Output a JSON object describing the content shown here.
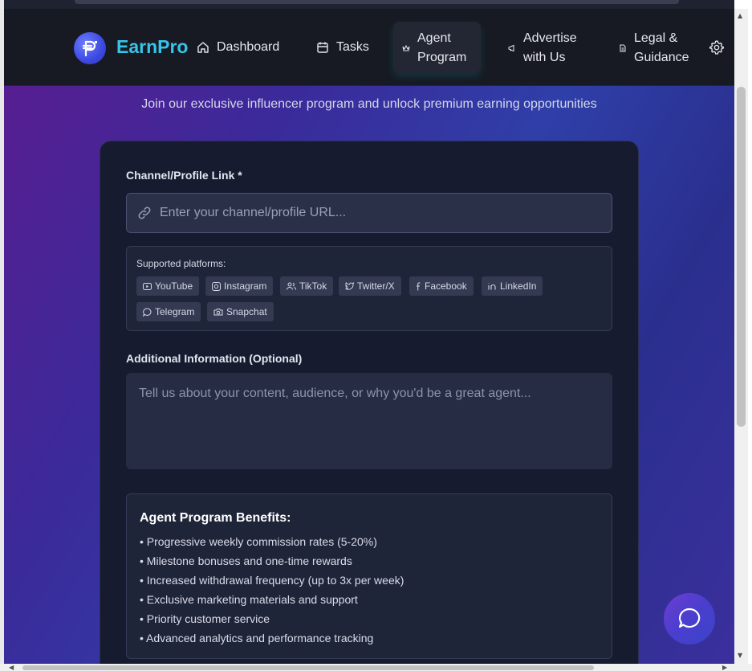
{
  "brand": {
    "name": "EarnPro",
    "logo_glyph": "₱"
  },
  "nav": {
    "items": [
      {
        "label_line1": "Dashboard",
        "label_line2": "",
        "icon": "home-icon"
      },
      {
        "label_line1": "Tasks",
        "label_line2": "",
        "icon": "calendar-icon"
      },
      {
        "label_line1": "Agent",
        "label_line2": "Program",
        "icon": "crown-icon",
        "active": true
      },
      {
        "label_line1": "Advertise",
        "label_line2": "with Us",
        "icon": "megaphone-icon"
      },
      {
        "label_line1": "Legal &",
        "label_line2": "Guidance",
        "icon": "document-icon"
      }
    ],
    "settings_icon": "gear-icon"
  },
  "hero": {
    "subtitle": "Join our exclusive influencer program and unlock premium earning opportunities"
  },
  "form": {
    "channel_label": "Channel/Profile Link *",
    "channel_placeholder": "Enter your channel/profile URL...",
    "channel_value": "",
    "platforms_title": "Supported platforms:",
    "platforms": [
      "YouTube",
      "Instagram",
      "TikTok",
      "Twitter/X",
      "Facebook",
      "LinkedIn",
      "Telegram",
      "Snapchat"
    ],
    "additional_label": "Additional Information (Optional)",
    "additional_placeholder": "Tell us about your content, audience, or why you'd be a great agent...",
    "additional_value": ""
  },
  "benefits": {
    "title": "Agent Program Benefits:",
    "items": [
      "• Progressive weekly commission rates (5-20%)",
      "• Milestone bonuses and one-time rewards",
      "• Increased withdrawal frequency (up to 3x per week)",
      "• Exclusive marketing materials and support",
      "• Priority customer service",
      "• Advanced analytics and performance tracking"
    ]
  },
  "colors": {
    "brand": "#38c4e8",
    "accent": "#4a3ecf",
    "navbar": "#171a22",
    "card": "#161b30"
  }
}
